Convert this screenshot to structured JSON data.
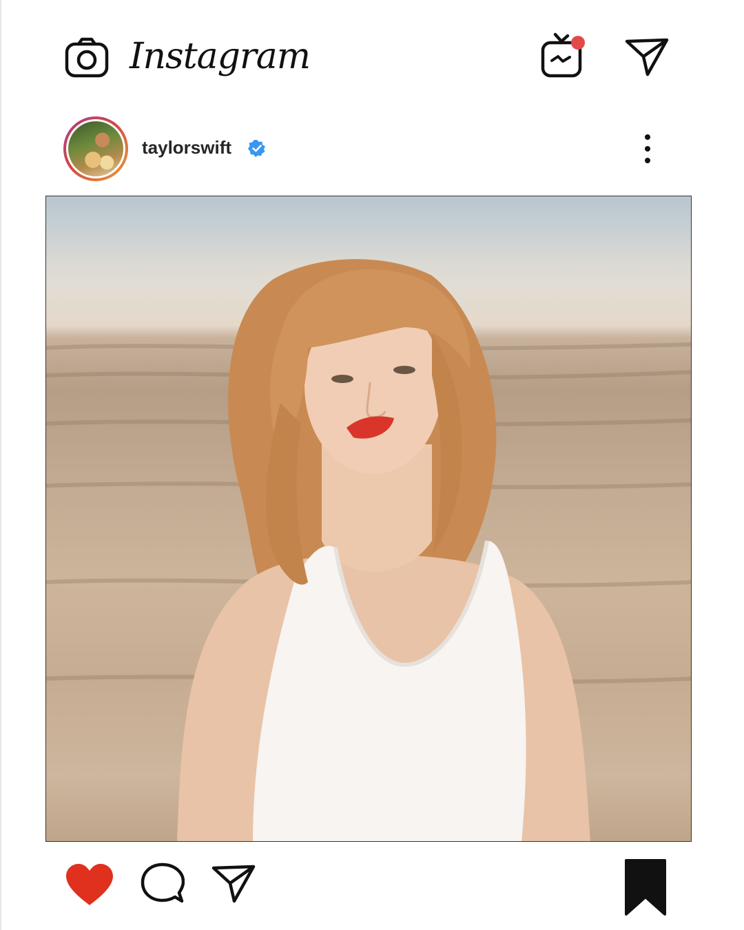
{
  "app": {
    "name": "Instagram",
    "accent_color": "#ed4956",
    "verified_color": "#3897f0"
  },
  "header": {
    "logo_text": "Instagram",
    "left_icon": "camera-icon",
    "right_icons": [
      "igtv-icon",
      "direct-send-icon"
    ],
    "notification_dot": true
  },
  "post": {
    "username": "taylorswift",
    "verified": true,
    "more_icon": "more-vertical-icon",
    "image_icon": "post-photo",
    "actions": {
      "like_icon": "heart-filled-icon",
      "liked": true,
      "comment_icon": "comment-icon",
      "share_icon": "send-icon",
      "save_icon": "bookmark-filled-icon",
      "saved": true
    }
  }
}
